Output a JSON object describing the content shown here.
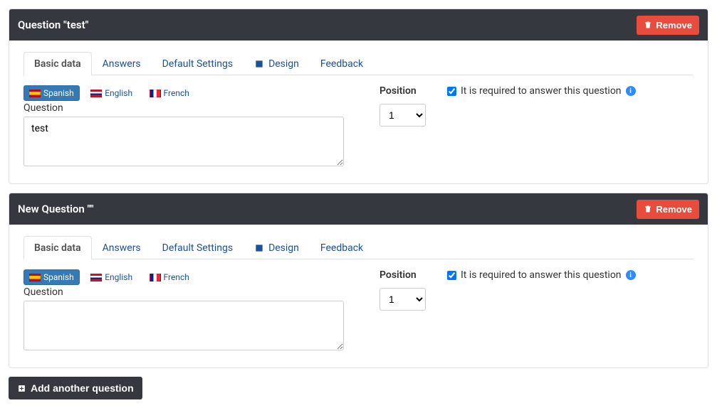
{
  "tabs": {
    "basic_data": "Basic data",
    "answers": "Answers",
    "default_settings": "Default Settings",
    "design": "Design",
    "feedback": "Feedback"
  },
  "languages": {
    "spanish": "Spanish",
    "english": "English",
    "french": "French"
  },
  "labels": {
    "question": "Question",
    "position": "Position",
    "required": "It is required to answer this question",
    "remove": "Remove",
    "add_another": "Add another question"
  },
  "questions": [
    {
      "title": "Question \"test\"",
      "text": "test",
      "position": "1",
      "required": true
    },
    {
      "title": "New Question \"\"",
      "text": "",
      "position": "1",
      "required": true
    }
  ]
}
